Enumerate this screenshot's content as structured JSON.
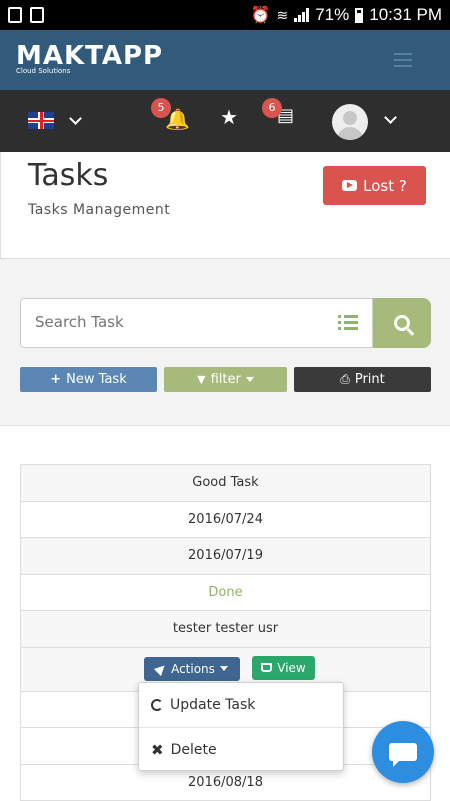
{
  "statusbar": {
    "battery": "71%",
    "time": "10:31 PM"
  },
  "brand": {
    "logo_text": "MAKTAPP",
    "logo_tagline": "Cloud Solutions"
  },
  "toolbar": {
    "language": "English",
    "notification_count": "5",
    "messages_count": "6"
  },
  "header": {
    "title": "Tasks",
    "subtitle": "Tasks Management",
    "lost_label": "Lost ?"
  },
  "search": {
    "placeholder": "Search Task"
  },
  "actions": {
    "new_label": "New Task",
    "filter_label": "filter",
    "print_label": "Print"
  },
  "task": {
    "name": "Good Task",
    "date1": "2016/07/24",
    "date2": "2016/07/19",
    "status": "Done",
    "assignee": "tester tester usr",
    "actions_label": "Actions",
    "view_label": "View",
    "date3": "2016/08/18"
  },
  "dropdown": {
    "update_label": "Update Task",
    "delete_label": "Delete"
  },
  "colors": {
    "brand": "#325a7a",
    "toolbar": "#2e2e2e",
    "danger": "#d9534f",
    "success": "#a6bb7a",
    "primary": "#5b87b4"
  }
}
